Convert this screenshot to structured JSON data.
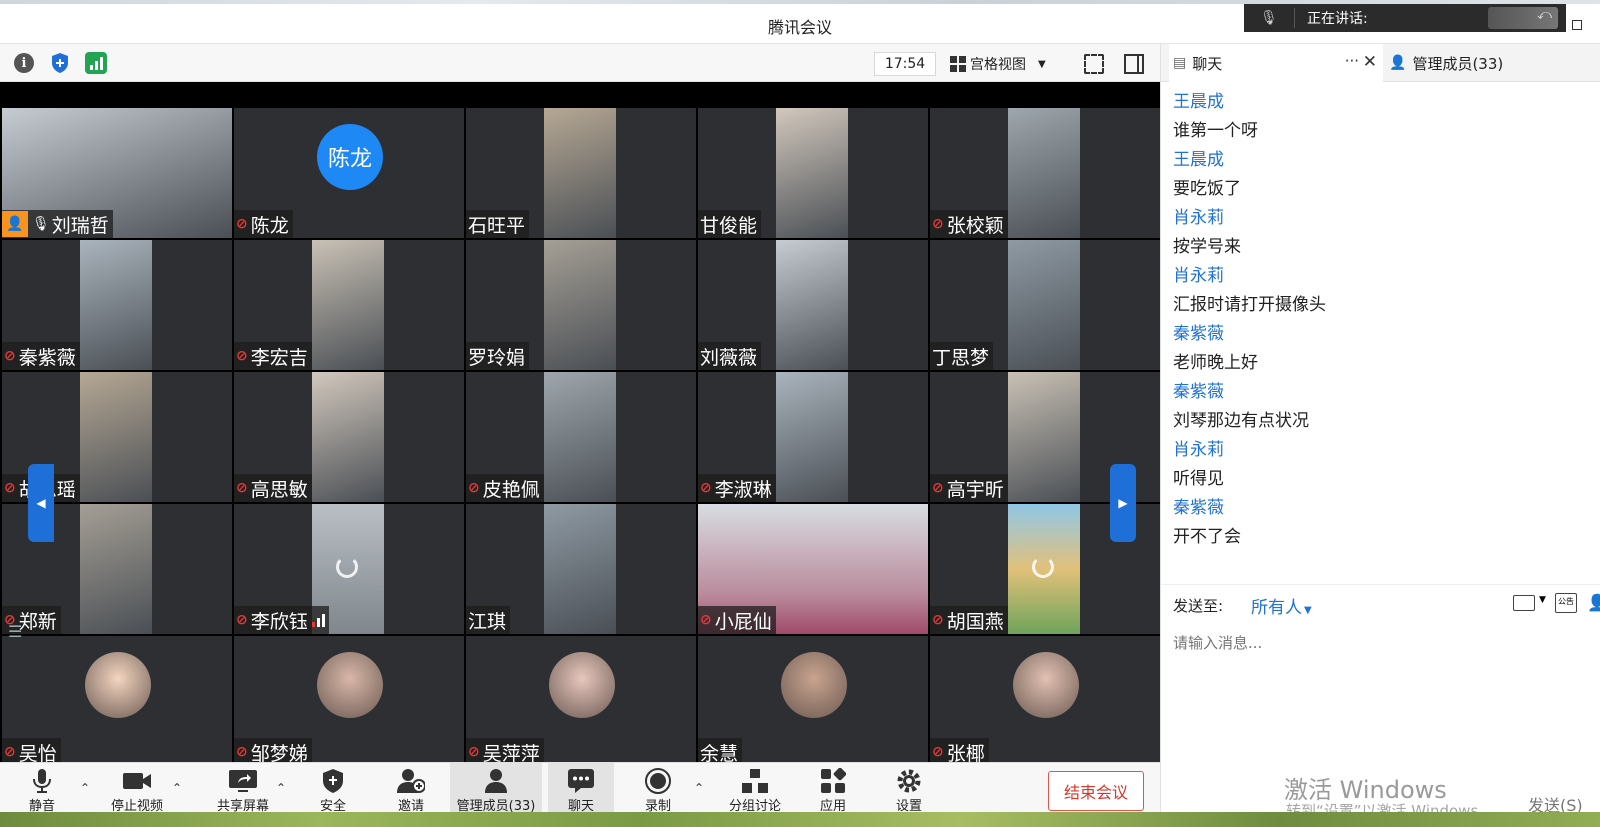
{
  "window": {
    "title": "腾讯会议",
    "speaking_label": "正在讲话:"
  },
  "toolbar": {
    "time": "17:54",
    "view_mode": "宫格视图"
  },
  "participants": [
    {
      "name": "刘瑞哲",
      "muted": false,
      "host": true,
      "type": "cam"
    },
    {
      "name": "陈龙",
      "muted": true,
      "host": false,
      "type": "initials",
      "initials": "陈龙"
    },
    {
      "name": "石旺平",
      "muted": false,
      "host": false,
      "type": "cam"
    },
    {
      "name": "甘俊能",
      "muted": false,
      "host": false,
      "type": "cam"
    },
    {
      "name": "张校颖",
      "muted": true,
      "host": false,
      "type": "cam"
    },
    {
      "name": "秦紫薇",
      "muted": true,
      "host": false,
      "type": "cam"
    },
    {
      "name": "李宏吉",
      "muted": true,
      "host": false,
      "type": "cam"
    },
    {
      "name": "罗玲娟",
      "muted": false,
      "host": false,
      "type": "cam"
    },
    {
      "name": "刘薇薇",
      "muted": false,
      "host": false,
      "type": "cam"
    },
    {
      "name": "丁思梦",
      "muted": false,
      "host": false,
      "type": "cam"
    },
    {
      "name": "胡思瑶",
      "muted": true,
      "host": false,
      "type": "cam"
    },
    {
      "name": "高思敏",
      "muted": true,
      "host": false,
      "type": "cam"
    },
    {
      "name": "皮艳佩",
      "muted": true,
      "host": false,
      "type": "cam"
    },
    {
      "name": "李淑琳",
      "muted": true,
      "host": false,
      "type": "cam"
    },
    {
      "name": "高宇昕",
      "muted": true,
      "host": false,
      "type": "cam"
    },
    {
      "name": "郑新",
      "muted": true,
      "host": false,
      "type": "cam"
    },
    {
      "name": "李欣钰",
      "muted": true,
      "host": false,
      "type": "loading"
    },
    {
      "name": "江琪",
      "muted": false,
      "host": false,
      "type": "cam"
    },
    {
      "name": "小屁仙",
      "muted": true,
      "host": false,
      "type": "wide"
    },
    {
      "name": "胡国燕",
      "muted": true,
      "host": false,
      "type": "loading"
    },
    {
      "name": "吴怡",
      "muted": true,
      "host": false,
      "type": "avatar"
    },
    {
      "name": "邹梦娣",
      "muted": true,
      "host": false,
      "type": "avatar"
    },
    {
      "name": "吴萍萍",
      "muted": true,
      "host": false,
      "type": "avatar"
    },
    {
      "name": "余慧",
      "muted": false,
      "host": false,
      "type": "avatar"
    },
    {
      "name": "张椰",
      "muted": true,
      "host": false,
      "type": "avatar"
    }
  ],
  "bottombar": {
    "mute": "静音",
    "stop_video": "停止视频",
    "share_screen": "共享屏幕",
    "security": "安全",
    "invite": "邀请",
    "members": "管理成员(33)",
    "chat": "聊天",
    "record": "录制",
    "breakout": "分组讨论",
    "apps": "应用",
    "settings": "设置",
    "end_meeting": "结束会议"
  },
  "chat": {
    "tab_chat": "聊天",
    "tab_members": "管理成员(33)",
    "messages": [
      {
        "sender": "王晨成",
        "text": "谁第一个呀"
      },
      {
        "sender": "王晨成",
        "text": "要吃饭了"
      },
      {
        "sender": "肖永莉",
        "text": "按学号来"
      },
      {
        "sender": "肖永莉",
        "text": "汇报时请打开摄像头"
      },
      {
        "sender": "秦紫薇",
        "text": "老师晚上好"
      },
      {
        "sender": "秦紫薇",
        "text": "刘琴那边有点状况"
      },
      {
        "sender": "肖永莉",
        "text": "听得见"
      },
      {
        "sender": "秦紫薇",
        "text": "开不了会"
      }
    ],
    "send_to_label": "发送至:",
    "send_to_target": "所有人",
    "input_placeholder": "请输入消息...",
    "send_button": "发送(S)"
  },
  "os": {
    "activate_title": "激活 Windows",
    "activate_sub": "转到“设置”以激活 Windows。"
  },
  "colors": {
    "accent": "#1f72d6",
    "end_meeting": "#d9362b",
    "host_badge": "#f7931e",
    "tile_bg": "#2d2f33"
  }
}
